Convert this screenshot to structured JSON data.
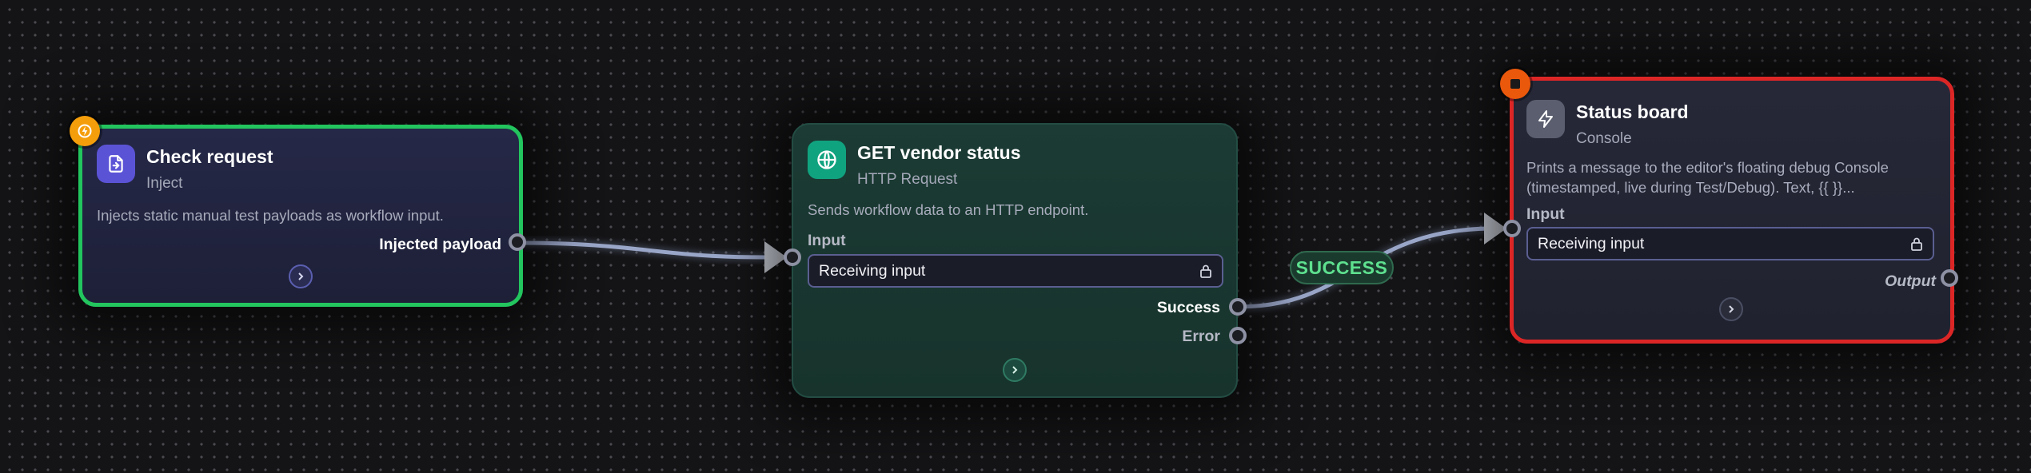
{
  "nodes": {
    "check_request": {
      "title": "Check request",
      "type": "Inject",
      "description": "Injects static manual test payloads as workflow input.",
      "output_label": "Injected payload",
      "icon": "inject-icon",
      "trigger_badge_icon": "bolt-icon",
      "border_color": "#22c55e"
    },
    "get_vendor_status": {
      "title": "GET vendor status",
      "type": "HTTP Request",
      "description": "Sends workflow data to an HTTP endpoint.",
      "input_section_label": "Input",
      "input_value": "Receiving input",
      "output_success_label": "Success",
      "output_error_label": "Error",
      "icon": "globe-icon"
    },
    "status_board": {
      "title": "Status board",
      "type": "Console",
      "description_line1": "Prints a message to the editor's floating debug Console",
      "description_line2": "(timestamped, live during Test/Debug). Text, {{ }}...",
      "input_section_label": "Input",
      "input_value": "Receiving input",
      "output_label": "Output",
      "icon": "bolt-icon",
      "stop_badge_icon": "stop-icon",
      "border_color": "#dc2626"
    }
  },
  "edges": {
    "success_label": "SUCCESS"
  },
  "colors": {
    "background": "#141416",
    "success_green": "#5ee08f",
    "trigger_orange": "#f59e0b",
    "stop_orange": "#ea580c"
  }
}
